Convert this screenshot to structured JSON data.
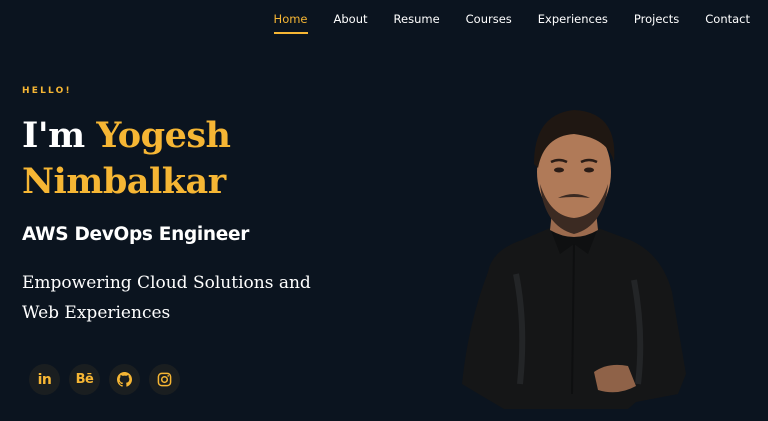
{
  "nav": {
    "items": [
      {
        "label": "Home",
        "active": true
      },
      {
        "label": "About"
      },
      {
        "label": "Resume"
      },
      {
        "label": "Courses"
      },
      {
        "label": "Experiences"
      },
      {
        "label": "Projects"
      },
      {
        "label": "Contact"
      }
    ]
  },
  "hero": {
    "greeting": "HELLO!",
    "name_prefix": "I'm",
    "first_name": "Yogesh",
    "last_name": "Nimbalkar",
    "role": "AWS DevOps Engineer",
    "tagline_line1": "Empowering Cloud Solutions and",
    "tagline_line2": "Web Experiences"
  },
  "socials": [
    {
      "icon": "linkedin-icon",
      "glyph": "in"
    },
    {
      "icon": "behance-icon",
      "glyph": "Bē"
    },
    {
      "icon": "github-icon",
      "glyph": ""
    },
    {
      "icon": "instagram-icon",
      "glyph": ""
    }
  ],
  "colors": {
    "background": "#0b141f",
    "accent": "#f6b634",
    "text": "#ffffff",
    "social_bg": "#1a1e20"
  }
}
